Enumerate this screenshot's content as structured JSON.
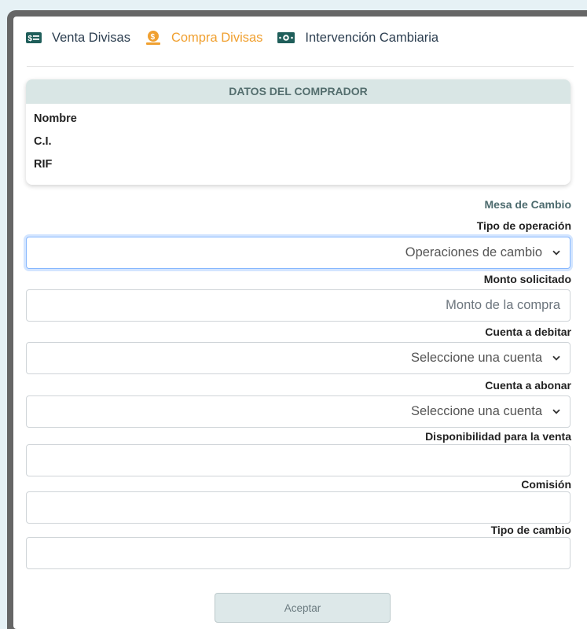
{
  "tabs": [
    {
      "label": "Venta Divisas",
      "icon": "money-bill-icon",
      "active": false
    },
    {
      "label": "Compra Divisas",
      "icon": "coin-hand-icon",
      "active": true
    },
    {
      "label": "Intervención Cambiaria",
      "icon": "banknote-icon",
      "active": false
    }
  ],
  "colors": {
    "active_tab": "#f0a030",
    "teal_icon": "#1f5e5a",
    "panel_header_bg": "#d9e6e5",
    "frame": "#666666",
    "page_bg": "#e6f1f5"
  },
  "buyer": {
    "header": "DATOS DEL COMPRADOR",
    "rows": [
      "Nombre",
      "C.I.",
      "RIF"
    ]
  },
  "form": {
    "section_title": "Mesa de Cambio",
    "tipo_operacion": {
      "label": "Tipo de operación",
      "value": "Operaciones de cambio"
    },
    "monto": {
      "label": "Monto solicitado",
      "placeholder": "Monto de la compra"
    },
    "cuenta_debitar": {
      "label": "Cuenta a debitar",
      "value": "Seleccione una cuenta"
    },
    "cuenta_abonar": {
      "label": "Cuenta a abonar",
      "value": "Seleccione una cuenta"
    },
    "disponibilidad": {
      "label": "Disponibilidad para la venta",
      "value": ""
    },
    "comision": {
      "label": "Comisión",
      "value": ""
    },
    "tipo_cambio": {
      "label": "Tipo de cambio",
      "value": ""
    }
  },
  "submit_label": "Aceptar"
}
